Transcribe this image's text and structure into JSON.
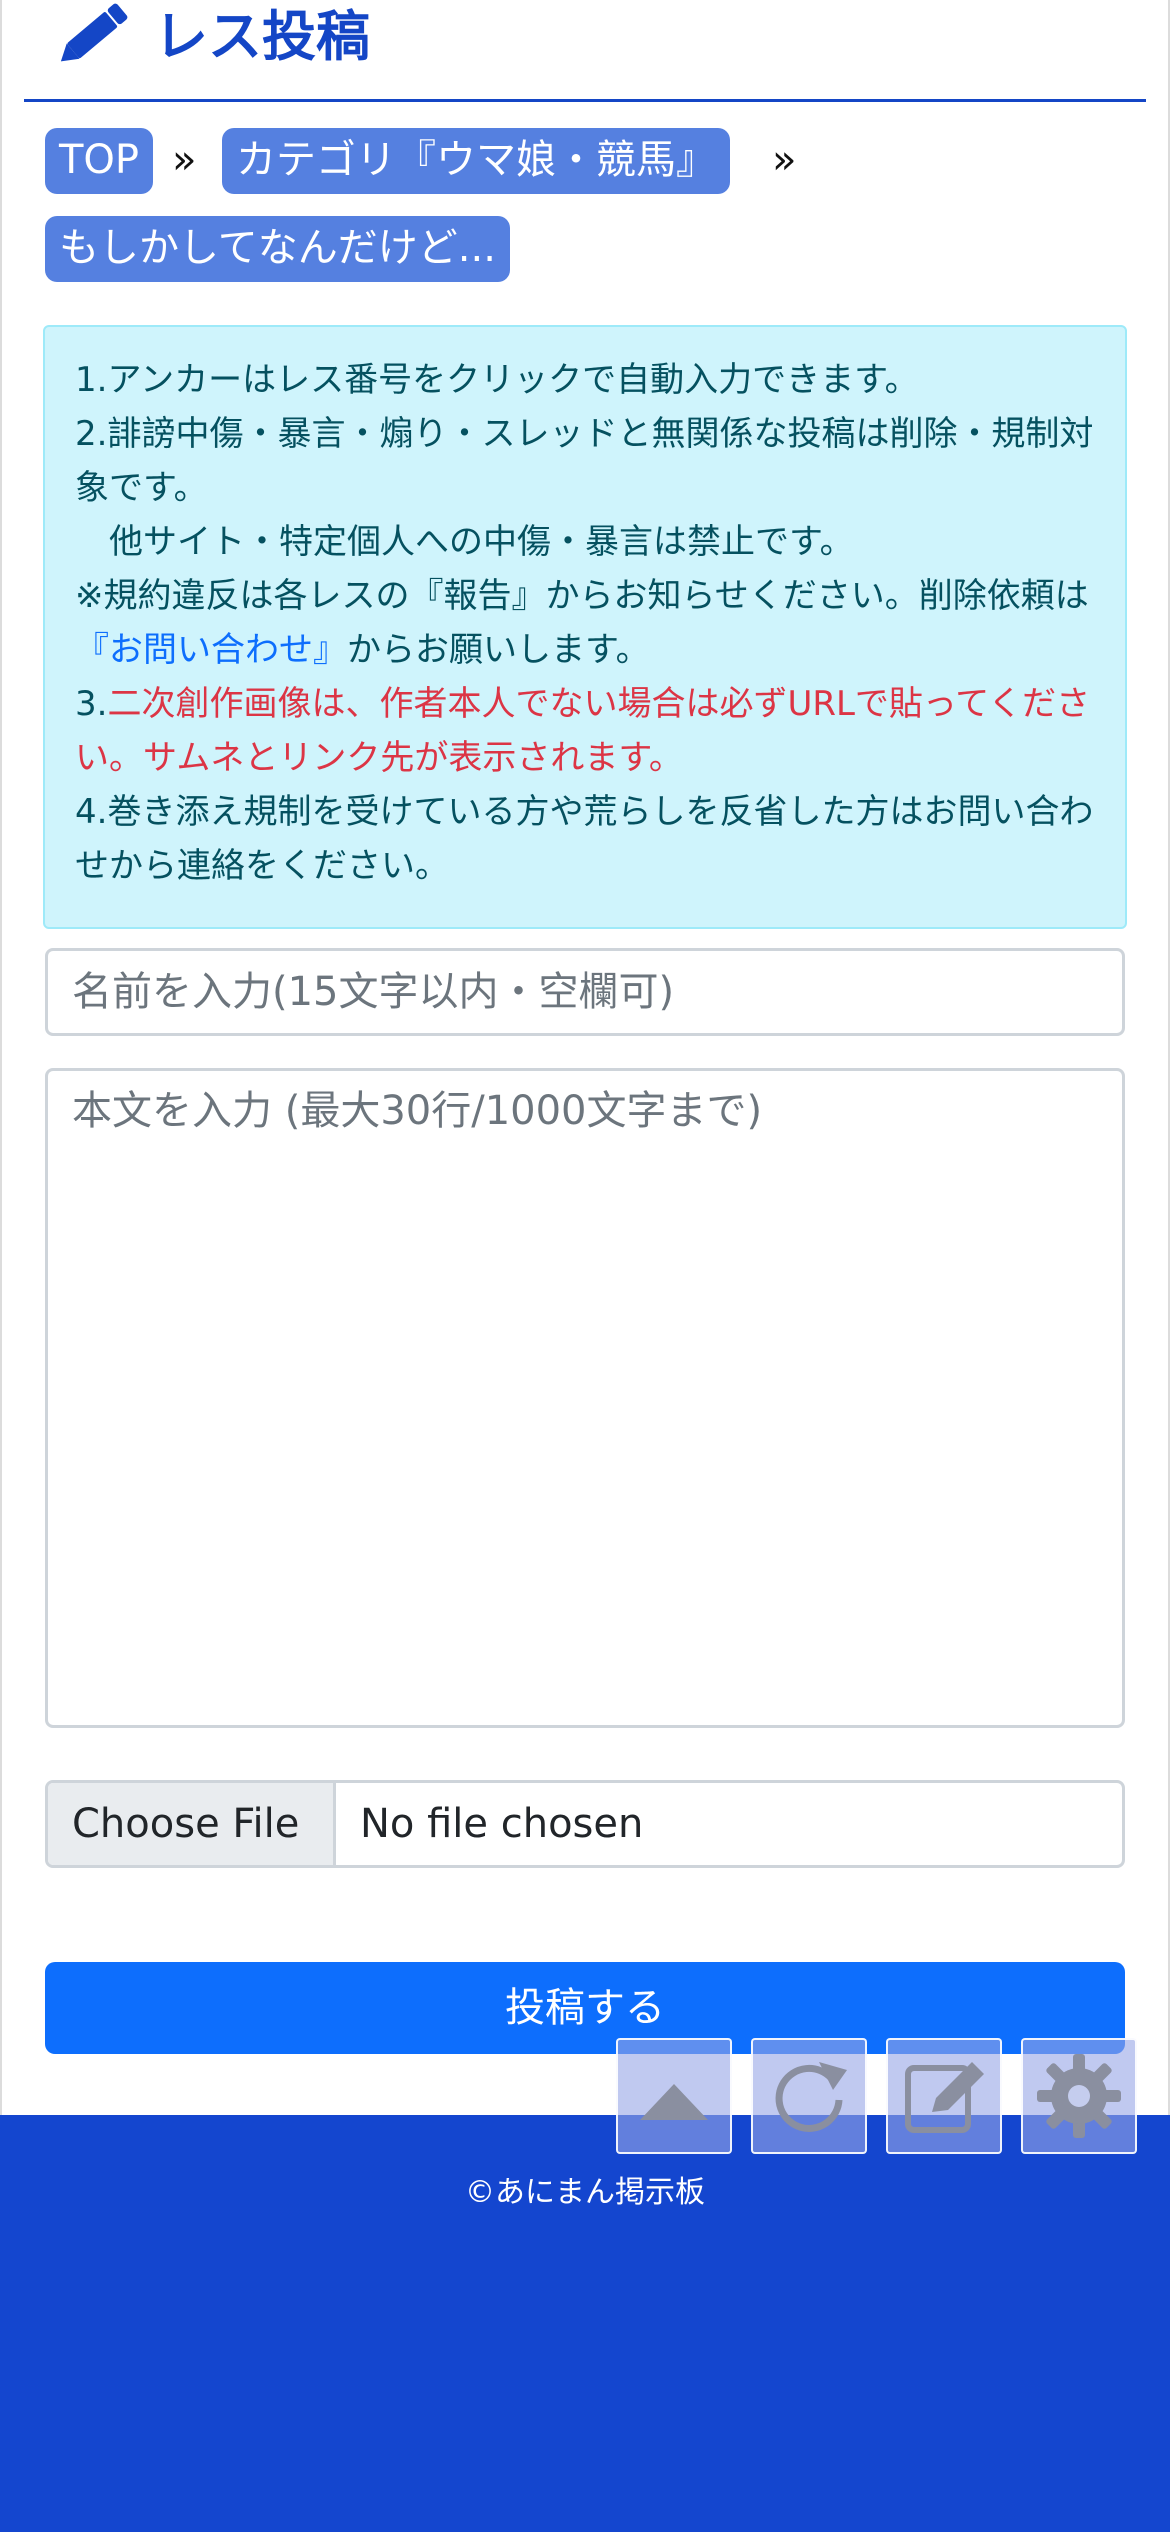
{
  "header": {
    "title": "レス投稿",
    "icon": "pencil-icon",
    "accent_color": "#1446c6"
  },
  "breadcrumb": {
    "items": [
      "TOP",
      "カテゴリ『ウマ娘・競馬』",
      "もしかしてなんだけど..."
    ],
    "separator": "»",
    "color": "#5580e0"
  },
  "notice": {
    "line1": "1.アンカーはレス番号をクリックで自動入力できます。",
    "line2": "2.誹謗中傷・暴言・煽り・スレッドと無関係な投稿は削除・規制対象です。",
    "line2b": "　他サイト・特定個人への中傷・暴言は禁止です。",
    "line2c_pre": "※規約違反は各レスの『報告』からお知らせください。削除依頼は",
    "line2c_link": "『お問い合わせ』",
    "line2c_post": "からお願いします。",
    "line3_num": "3.",
    "line3_text": "二次創作画像は、作者本人でない場合は必ずURLで貼ってください。サムネとリンク先が表示されます。",
    "line4": "4.巻き添え規制を受けている方や荒らしを反省した方はお問い合わせから連絡をください。"
  },
  "form": {
    "name_placeholder": "名前を入力(15文字以内・空欄可)",
    "body_placeholder": "本文を入力 (最大30行/1000文字まで)",
    "file_button": "Choose File",
    "file_status": "No file chosen",
    "submit_label": "投稿する"
  },
  "footer": {
    "copyright": "©あにまん掲示板",
    "color": "#1446cf"
  },
  "floating_buttons": [
    "scroll-top-icon",
    "reload-icon",
    "edit-icon",
    "settings-icon"
  ]
}
